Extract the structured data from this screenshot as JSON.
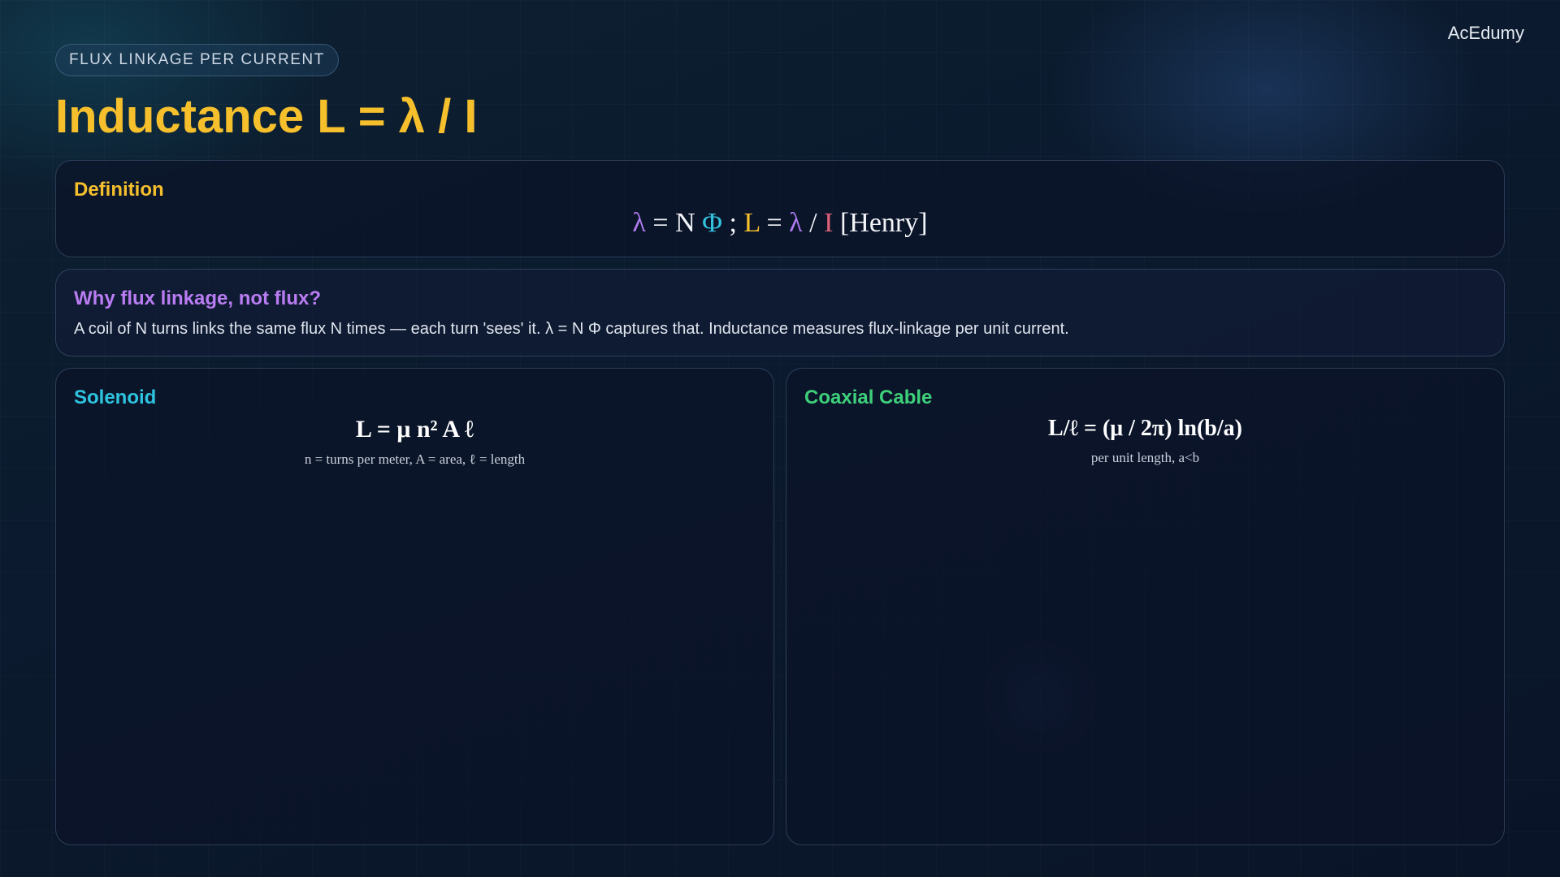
{
  "brand": "AcEdumy",
  "badge": "FLUX LINKAGE PER CURRENT",
  "title": "Inductance L = λ / I",
  "definition": {
    "heading": "Definition",
    "equation": {
      "p1": "λ",
      "p2": " = N ",
      "p3": "Φ",
      "p4": " ; ",
      "p5": "L",
      "p6": " = ",
      "p7": "λ",
      "p8": " / ",
      "p9": "I",
      "p10": " [Henry]"
    }
  },
  "why": {
    "heading": "Why flux linkage, not flux?",
    "text": "A coil of N turns links the same flux N times — each turn 'sees' it. λ = N Φ captures that. Inductance measures flux-linkage per unit current."
  },
  "solenoid": {
    "heading": "Solenoid",
    "formula": "L = μ n² A ℓ",
    "note": "n = turns per meter, A = area, ℓ = length"
  },
  "coax": {
    "heading": "Coaxial Cable",
    "formula": "L/ℓ = (μ / 2π) ln(b/a)",
    "note": "per unit length, a<b"
  },
  "colors": {
    "accent_gold": "#f6bf2c",
    "purple": "#b07cf0",
    "cyan": "#33c4e0",
    "red": "#e2607a",
    "green": "#3ecf7a"
  }
}
